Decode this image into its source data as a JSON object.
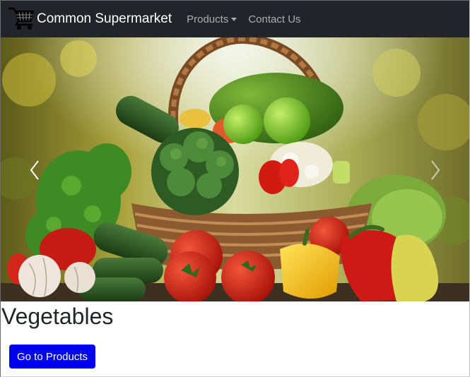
{
  "navbar": {
    "brand_icon": "shopping-cart-icon",
    "brand_text": "Common Supermarket",
    "products_label": "Products",
    "products_caret_icon": "caret-down-icon",
    "contact_label": "Contact Us",
    "background": "#212529"
  },
  "carousel": {
    "prev_icon": "chevron-left-icon",
    "next_icon": "chevron-right-icon"
  },
  "section": {
    "title": "Vegetables",
    "button_label": "Go to Products",
    "button_color": "#0000ee"
  }
}
